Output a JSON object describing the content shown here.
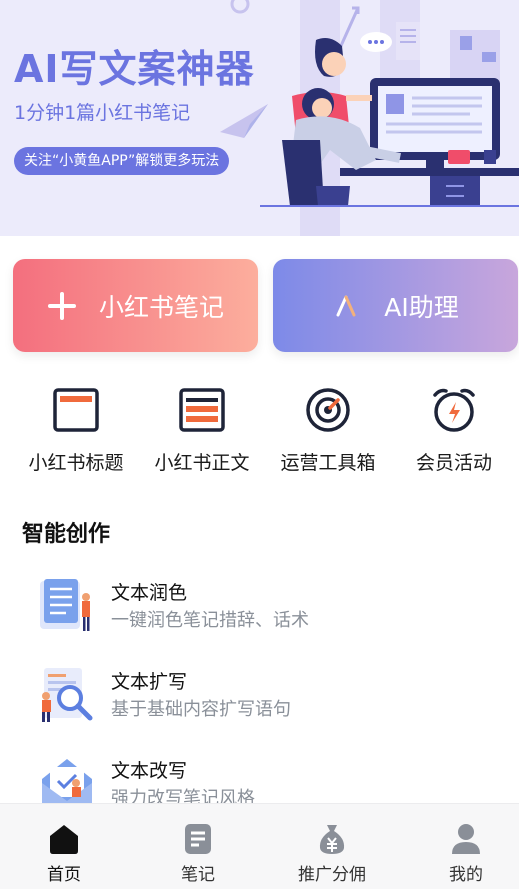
{
  "banner": {
    "title": "AI写文案神器",
    "subtitle": "1分钟1篇小红书笔记",
    "pill": "关注“小黄鱼APP”解锁更多玩法"
  },
  "actions": {
    "note_label": "小红书笔记",
    "ai_label": "AI助理"
  },
  "quick_tools": [
    {
      "label": "小红书标题",
      "icon": "title-card-icon"
    },
    {
      "label": "小红书正文",
      "icon": "body-text-card-icon"
    },
    {
      "label": "运营工具箱",
      "icon": "target-gauge-icon"
    },
    {
      "label": "会员活动",
      "icon": "alarm-clock-icon"
    }
  ],
  "section": {
    "title": "智能创作",
    "items": [
      {
        "title": "文本润色",
        "desc": "一键润色笔记措辞、话术"
      },
      {
        "title": "文本扩写",
        "desc": "基于基础内容扩写语句"
      },
      {
        "title": "文本改写",
        "desc": "强力改写笔记风格"
      }
    ]
  },
  "tabbar": [
    {
      "label": "首页",
      "icon": "home-icon"
    },
    {
      "label": "笔记",
      "icon": "notes-icon"
    },
    {
      "label": "推广分佣",
      "icon": "money-bag-icon"
    },
    {
      "label": "我的",
      "icon": "user-icon"
    }
  ],
  "colors": {
    "accent": "#6b74e0",
    "note_gradient": [
      "#f46f7e",
      "#fcae9d"
    ],
    "ai_gradient": [
      "#7d8ae8",
      "#c8a6dc"
    ],
    "icon_orange": "#f06a3c",
    "icon_dark": "#1e2438"
  }
}
